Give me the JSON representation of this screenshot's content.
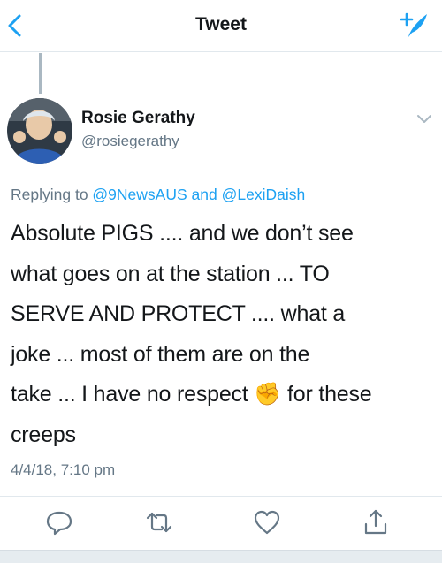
{
  "header": {
    "title": "Tweet",
    "back_icon": "chevron-left-icon",
    "compose_icon": "compose-tweet-icon",
    "accent": "#1da1f2"
  },
  "tweet": {
    "display_name": "Rosie Gerathy",
    "handle": "@rosiegerathy",
    "replying_prefix": "Replying to ",
    "reply_to_1": "@9NewsAUS",
    "reply_and": " and ",
    "reply_to_2": "@LexiDaish",
    "text_before_emoji": "Absolute PIGS .... and we don’t see\nwhat goes on at the station ... TO\nSERVE AND PROTECT .... what a\njoke ... most of them are on the\ntake ... I have no respect ",
    "emoji": "✊",
    "text_after_emoji": " for these\ncreeps",
    "timestamp": "4/4/18, 7:10 pm"
  },
  "actions": {
    "reply_icon": "reply-icon",
    "retweet_icon": "retweet-icon",
    "like_icon": "heart-icon",
    "share_icon": "share-icon"
  },
  "colors": {
    "text": "#14171a",
    "secondary": "#657786",
    "divider": "#e1e8ed"
  }
}
